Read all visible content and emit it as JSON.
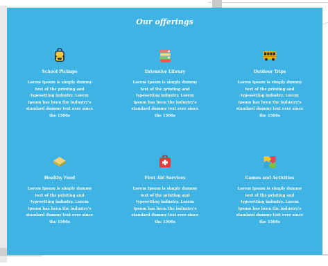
{
  "section": {
    "title": "Our offerings"
  },
  "offerings": [
    {
      "icon": "backpack-icon",
      "name": "School Pickups",
      "description": "Lorem Ipsum is simply dummy text of the printing and typesetting industry. Lorem Ipsum has been the industry's standard dummy text ever since the 1500s"
    },
    {
      "icon": "books-icon",
      "name": "Extensive Library",
      "description": "Lorem Ipsum is simply dummy text of the printing and typesetting industry. Lorem Ipsum has been the industry's standard dummy text ever since the 1500s"
    },
    {
      "icon": "bus-icon",
      "name": "Outdoor Trips",
      "description": "Lorem Ipsum is simply dummy text of the printing and typesetting industry. Lorem Ipsum has been the industry's standard dummy text ever since the 1500s"
    },
    {
      "icon": "sandwich-icon",
      "name": "Healthy Food",
      "description": "Lorem Ipsum is simply dummy text of the printing and typesetting industry. Lorem Ipsum has been the industry's standard dummy text ever since the 1500s"
    },
    {
      "icon": "first-aid-kit-icon",
      "name": "First Aid Services",
      "description": "Lorem Ipsum is simply dummy text of the printing and typesetting industry. Lorem Ipsum has been the industry's standard dummy text ever since the 1500s"
    },
    {
      "icon": "puzzle-icon",
      "name": "Games and Activities",
      "description": "Lorem Ipsum is simply dummy text of the printing and typesetting industry. Lorem Ipsum has been the industry's standard dummy text ever since the 1500s"
    }
  ],
  "colors": {
    "panel_background": "#3fb3e3",
    "text": "#ffffff"
  }
}
